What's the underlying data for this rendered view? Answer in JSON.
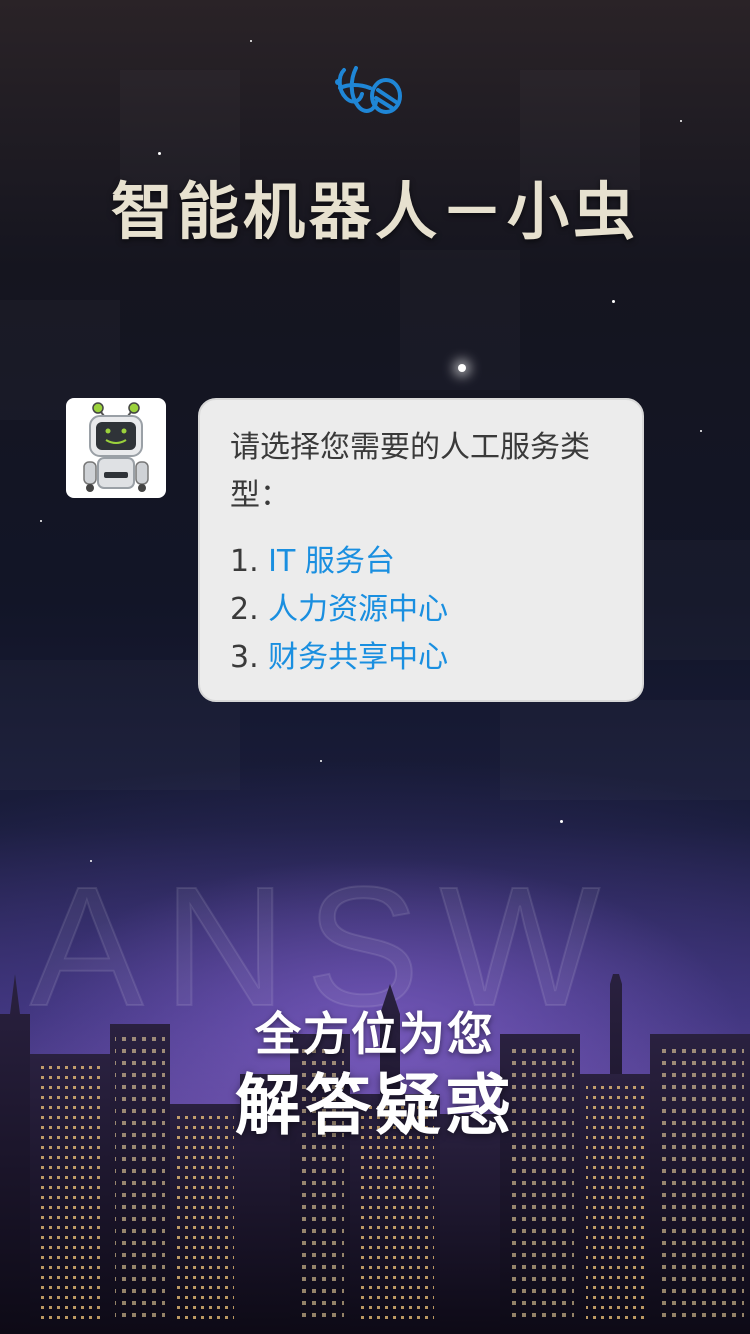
{
  "app_title": "智能机器人－小虫",
  "chat": {
    "prompt": "请选择您需要的人工服务类型：",
    "options": [
      {
        "number": "1.",
        "label": "IT 服务台"
      },
      {
        "number": "2.",
        "label": "人力资源中心"
      },
      {
        "number": "3.",
        "label": "财务共享中心"
      }
    ]
  },
  "background": {
    "watermark_text": "ANSW"
  },
  "tagline": {
    "line1": "全方位为您",
    "line2": "解答疑惑"
  },
  "icons": {
    "logo": "bee-logo-icon",
    "avatar": "robot-avatar-icon"
  },
  "colors": {
    "link": "#1a8fe0",
    "bubble_bg": "#ececec",
    "logo": "#1f86d6",
    "title": "#e7e1cf"
  }
}
